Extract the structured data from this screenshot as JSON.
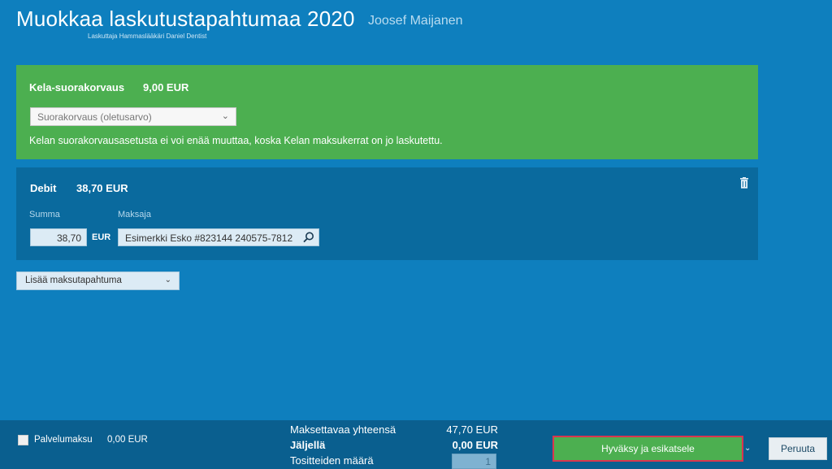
{
  "header": {
    "title": "Muokkaa laskutustapahtumaa 2020",
    "patient": "Joosef Maijanen",
    "biller": "Laskuttaja Hammaslääkäri Daniel Dentist"
  },
  "kela": {
    "title": "Kela-suorakorvaus",
    "amount": "9,00 EUR",
    "select_value": "Suorakorvaus (oletusarvo)",
    "note": "Kelan suorakorvausasetusta ei voi enää muuttaa, koska Kelan maksukerrat on jo laskutettu.",
    "color": "#4caf50"
  },
  "debit": {
    "title": "Debit",
    "amount": "38,70 EUR",
    "summa_label": "Summa",
    "maksaja_label": "Maksaja",
    "summa_value": "38,70",
    "currency": "EUR",
    "payer_value": "Esimerkki Esko #823144 240575-7812"
  },
  "add_payment": {
    "label": "Lisää maksutapahtuma"
  },
  "footer": {
    "service_fee_label": "Palvelumaksu",
    "service_fee_amount": "0,00 EUR",
    "total_label": "Maksettavaa yhteensä",
    "total_value": "47,70 EUR",
    "remaining_label": "Jäljellä",
    "remaining_value": "0,00 EUR",
    "documents_label": "Tositteiden määrä",
    "documents_value": "1",
    "approve_label": "Hyväksy ja esikatsele",
    "cancel_label": "Peruuta"
  },
  "colors": {
    "background": "#0e7fbe",
    "accent_green": "#4caf50",
    "panel_dark": "#0a6a9e",
    "footer": "#0a5f8f",
    "highlight_border": "#d9364f"
  }
}
